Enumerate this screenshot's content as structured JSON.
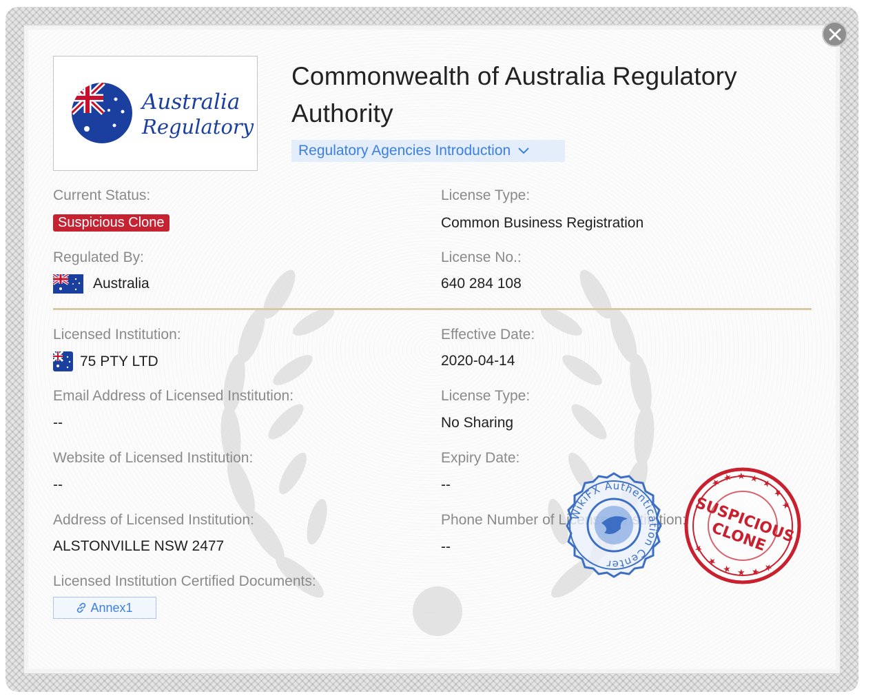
{
  "title": "Commonwealth of Australia Regulatory Authority",
  "logo": {
    "line1": "Australia",
    "line2": "Regulatory"
  },
  "intro_button": {
    "label": "Regulatory Agencies Introduction"
  },
  "fields": {
    "current_status": {
      "label": "Current Status:",
      "value": "Suspicious Clone"
    },
    "license_type_1": {
      "label": "License Type:",
      "value": "Common Business Registration"
    },
    "regulated_by": {
      "label": "Regulated By:",
      "value": "Australia"
    },
    "license_no": {
      "label": "License No.:",
      "value": "640 284 108"
    },
    "licensed_institution": {
      "label": "Licensed Institution:",
      "value": "75 PTY LTD"
    },
    "effective_date": {
      "label": "Effective Date:",
      "value": "2020-04-14"
    },
    "email": {
      "label": "Email Address of Licensed Institution:",
      "value": "--"
    },
    "license_type_2": {
      "label": "License Type:",
      "value": "No Sharing"
    },
    "website": {
      "label": "Website of Licensed Institution:",
      "value": "--"
    },
    "expiry_date": {
      "label": "Expiry Date:",
      "value": "--"
    },
    "address": {
      "label": "Address of Licensed Institution:",
      "value": "ALSTONVILLE NSW 2477"
    },
    "phone": {
      "label": "Phone Number of Licensed Institution:",
      "value": "--"
    },
    "documents": {
      "label": "Licensed Institution Certified Documents:",
      "annex_label": "Annex1"
    }
  },
  "stamps": {
    "blue": "WikiFX Authentication Center",
    "red": {
      "line1": "SUSPICIOUS",
      "line2": "CLONE"
    }
  },
  "colors": {
    "status_red": "#c52332",
    "link_blue": "#3b7fe0",
    "divider_gold": "#d8c8a3"
  },
  "icons": {
    "close": "close-icon",
    "chevron": "chevron-down-icon",
    "link": "link-icon",
    "flag": "australia-flag-icon"
  }
}
